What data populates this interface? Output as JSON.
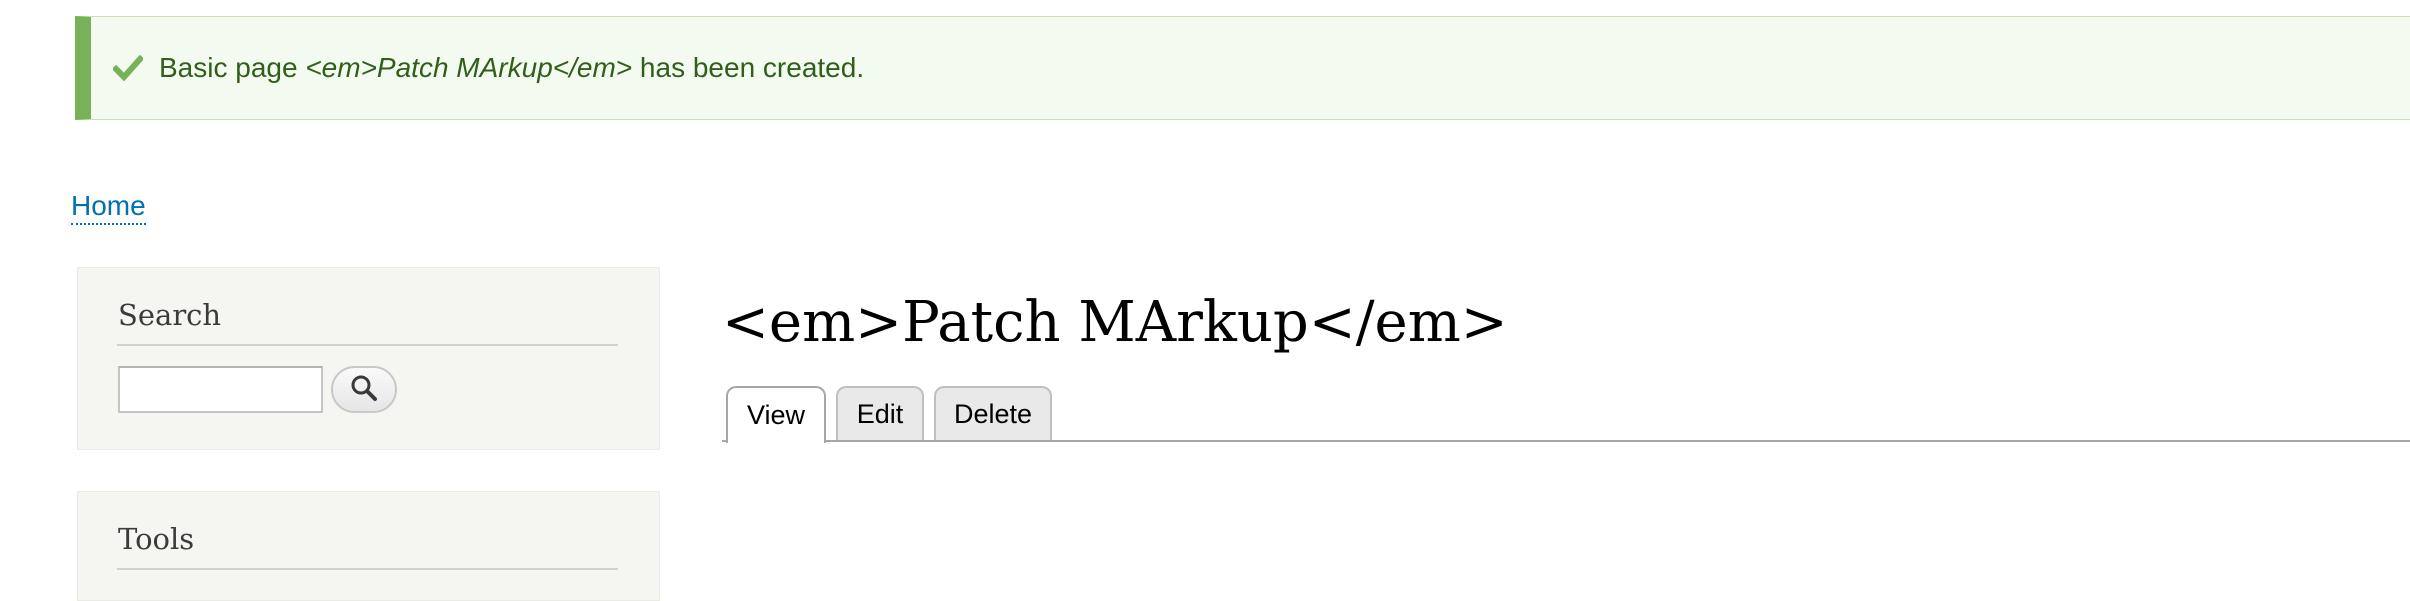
{
  "messages": {
    "status": {
      "prefix": "Basic page ",
      "title": "<em>Patch MArkup</em>",
      "suffix": " has been created.",
      "icon": "checkmark-icon",
      "accent_color": "#77b259"
    }
  },
  "breadcrumb": {
    "items": [
      {
        "label": "Home"
      }
    ]
  },
  "sidebar": {
    "search_block": {
      "title": "Search",
      "input_value": "",
      "button_icon": "search-icon"
    },
    "tools_block": {
      "title": "Tools"
    }
  },
  "main": {
    "page_title": "<em>Patch MArkup</em>",
    "tabs": [
      {
        "label": "View",
        "active": true
      },
      {
        "label": "Edit",
        "active": false
      },
      {
        "label": "Delete",
        "active": false
      }
    ]
  },
  "colors": {
    "link": "#0071b3",
    "status_background": "#f3faef",
    "status_text": "#325e1c"
  }
}
